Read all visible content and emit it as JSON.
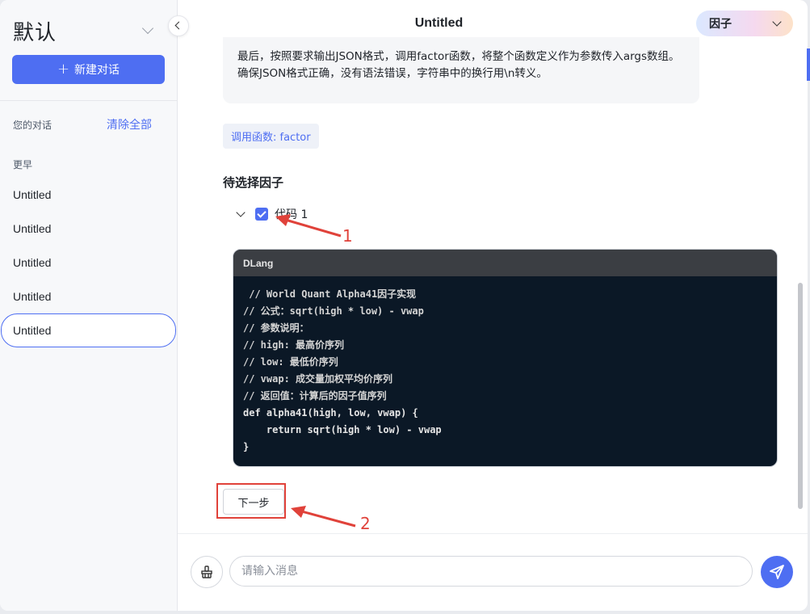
{
  "sidebar": {
    "workspace_title": "默认",
    "new_chat_label": "新建对话",
    "conversations_label": "您的对话",
    "clear_all_label": "清除全部",
    "group_older_label": "更早",
    "items": [
      {
        "label": "Untitled",
        "active": false
      },
      {
        "label": "Untitled",
        "active": false
      },
      {
        "label": "Untitled",
        "active": false
      },
      {
        "label": "Untitled",
        "active": false
      },
      {
        "label": "Untitled",
        "active": true
      }
    ]
  },
  "header": {
    "title": "Untitled",
    "model_select": "因子"
  },
  "chat": {
    "message_text": "最后，按照要求输出JSON格式，调用factor函数，将整个函数定义作为参数传入args数组。确保JSON格式正确，没有语法错误，字符串中的换行用\\n转义。",
    "function_call_tag": "调用函数: factor",
    "section_title": "待选择因子",
    "tree_item_label": "代码 1",
    "tree_item_checked": true,
    "code_language": "DLang",
    "code_lines": [
      " // World Quant Alpha41因子实现",
      "// 公式：sqrt(high * low) - vwap",
      "// 参数说明：",
      "// high: 最高价序列",
      "// low: 最低价序列",
      "// vwap: 成交量加权平均价序列",
      "// 返回值：计算后的因子值序列",
      "def alpha41(high, low, vwap) {",
      "    return sqrt(high * low) - vwap",
      "}"
    ],
    "next_button_label": "下一步"
  },
  "composer": {
    "placeholder": "请输入消息",
    "value": ""
  },
  "annotations": {
    "label_1": "1",
    "label_2": "2",
    "color": "#e0423a"
  },
  "colors": {
    "accent": "#4e6ef2",
    "code_bg": "#0b1826",
    "code_header_bg": "#3b3e43"
  }
}
